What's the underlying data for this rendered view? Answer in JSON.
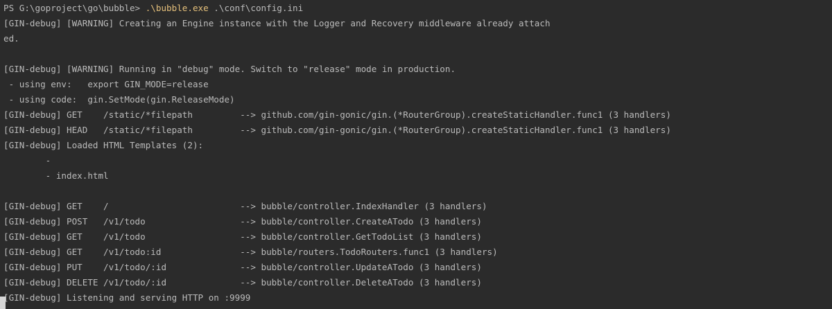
{
  "terminal": {
    "prompt": "PS G:\\goproject\\go\\bubble> ",
    "command_exe": ".\\bubble.exe",
    "command_args": " .\\conf\\config.ini",
    "lines": [
      "[GIN-debug] [WARNING] Creating an Engine instance with the Logger and Recovery middleware already attach",
      "ed.",
      "",
      "[GIN-debug] [WARNING] Running in \"debug\" mode. Switch to \"release\" mode in production.",
      " - using env:   export GIN_MODE=release",
      " - using code:  gin.SetMode(gin.ReleaseMode)",
      "[GIN-debug] GET    /static/*filepath         --> github.com/gin-gonic/gin.(*RouterGroup).createStaticHandler.func1 (3 handlers)",
      "[GIN-debug] HEAD   /static/*filepath         --> github.com/gin-gonic/gin.(*RouterGroup).createStaticHandler.func1 (3 handlers)",
      "[GIN-debug] Loaded HTML Templates (2):",
      "        -",
      "        - index.html",
      "",
      "[GIN-debug] GET    /                         --> bubble/controller.IndexHandler (3 handlers)",
      "[GIN-debug] POST   /v1/todo                  --> bubble/controller.CreateATodo (3 handlers)",
      "[GIN-debug] GET    /v1/todo                  --> bubble/controller.GetTodoList (3 handlers)",
      "[GIN-debug] GET    /v1/todo:id               --> bubble/routers.TodoRouters.func1 (3 handlers)",
      "[GIN-debug] PUT    /v1/todo/:id              --> bubble/controller.UpdateATodo (3 handlers)",
      "[GIN-debug] DELETE /v1/todo/:id              --> bubble/controller.DeleteATodo (3 handlers)",
      "[GIN-debug] Listening and serving HTTP on :9999"
    ]
  },
  "colors": {
    "background": "#2b2b2b",
    "text": "#bbbbbb",
    "command_highlight": "#e5c07b",
    "cursor": "#d6d6d6"
  }
}
